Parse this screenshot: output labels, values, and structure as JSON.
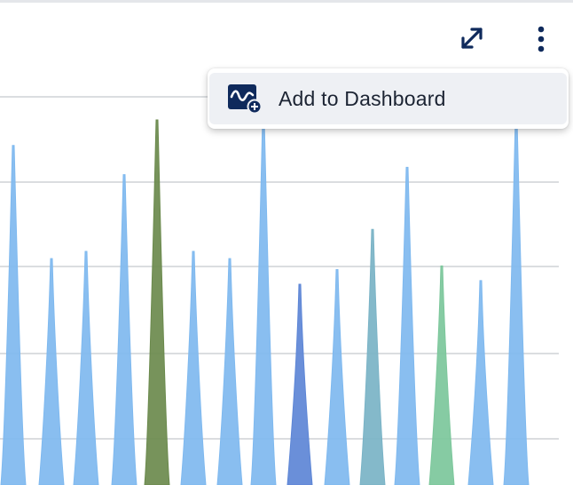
{
  "toolbar": {
    "expand_icon": "expand-arrows-icon",
    "more_icon": "more-vertical-icon"
  },
  "menu": {
    "items": [
      {
        "label": "Add to Dashboard",
        "icon": "add-chart-icon"
      }
    ]
  },
  "colors": {
    "accent": "#0f2a5c",
    "gridline": "#cfd2d6",
    "spike_blue": "#7fb9ef",
    "spike_green": "#6b8a4d",
    "spike_dark_blue": "#5d86d6",
    "spike_teal": "#7ab3c6",
    "spike_mint": "#7cc79b"
  },
  "chart_data": {
    "type": "area",
    "series": [
      {
        "color": "#7fb9ef",
        "values": [
          0.93,
          0.62,
          0.64,
          0.85,
          0,
          0.64,
          0.62,
          1.0,
          0,
          0.59,
          0,
          0.87,
          0,
          0.56,
          1.0
        ]
      },
      {
        "color": "#6b8a4d",
        "values": [
          0,
          0,
          0,
          0,
          1.0,
          0,
          0,
          0,
          0,
          0,
          0,
          0,
          0,
          0,
          0
        ]
      },
      {
        "color": "#5d86d6",
        "values": [
          0,
          0,
          0,
          0,
          0,
          0,
          0,
          0,
          0.55,
          0,
          0,
          0,
          0,
          0,
          0
        ]
      },
      {
        "color": "#7ab3c6",
        "values": [
          0,
          0,
          0,
          0,
          0,
          0,
          0,
          0,
          0,
          0,
          0.7,
          0,
          0,
          0,
          0
        ]
      },
      {
        "color": "#7cc79b",
        "values": [
          0,
          0,
          0,
          0,
          0,
          0,
          0,
          0,
          0,
          0,
          0,
          0,
          0.6,
          0,
          0
        ]
      }
    ]
  }
}
